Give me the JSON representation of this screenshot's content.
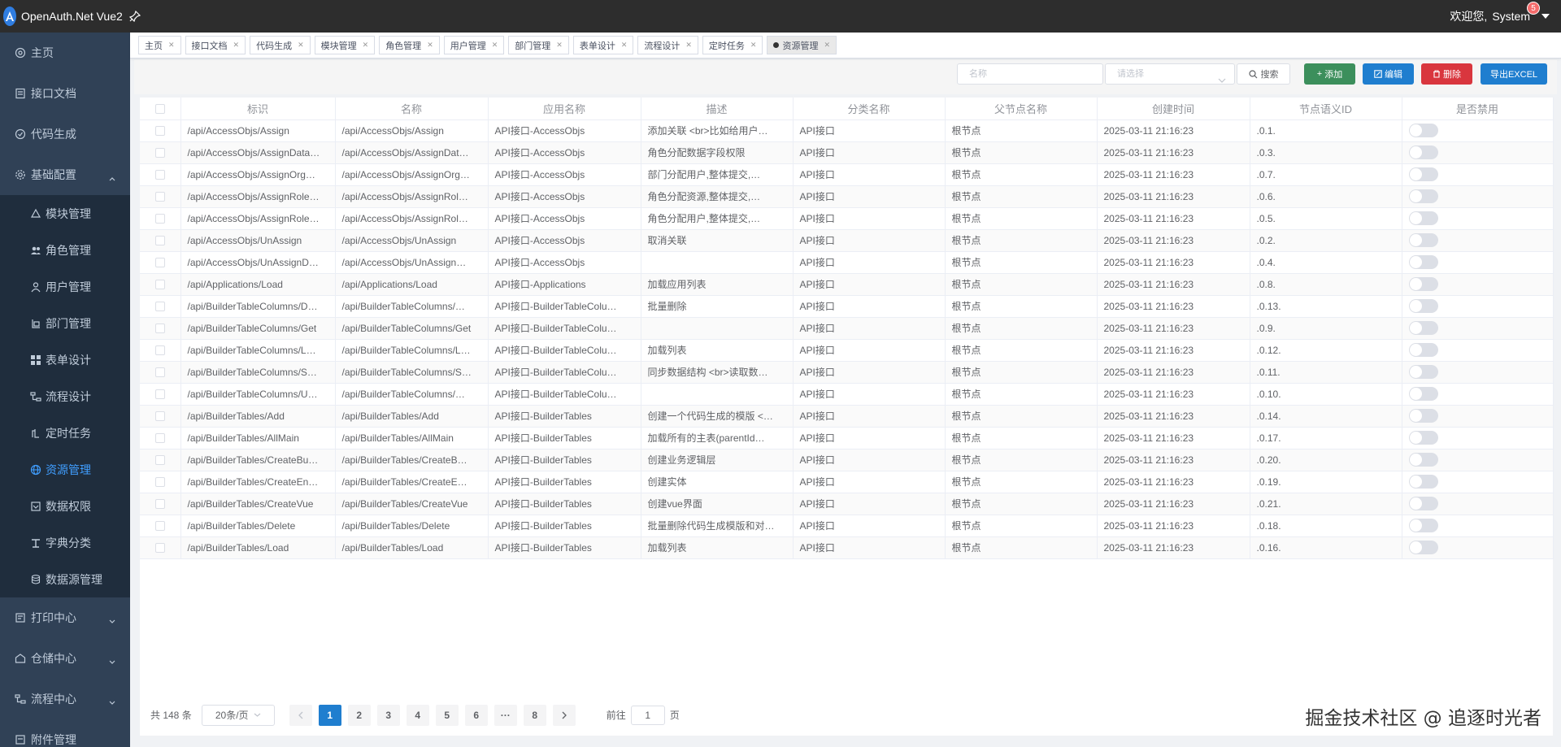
{
  "app": {
    "title": "OpenAuth.Net Vue2",
    "brand_color": "#2f7de1"
  },
  "user": {
    "greeting": "欢迎您,",
    "name": "System",
    "badge": "5"
  },
  "sidebar": {
    "items": [
      {
        "label": "主页",
        "icon": "home-icon"
      },
      {
        "label": "接口文档",
        "icon": "doc-icon"
      },
      {
        "label": "代码生成",
        "icon": "code-icon"
      },
      {
        "label": "基础配置",
        "icon": "gear-icon",
        "expanded": true
      }
    ],
    "sub_items": [
      {
        "label": "模块管理",
        "icon": "module-icon"
      },
      {
        "label": "角色管理",
        "icon": "role-icon"
      },
      {
        "label": "用户管理",
        "icon": "user-icon"
      },
      {
        "label": "部门管理",
        "icon": "dept-icon"
      },
      {
        "label": "表单设计",
        "icon": "form-icon"
      },
      {
        "label": "流程设计",
        "icon": "flow-icon"
      },
      {
        "label": "定时任务",
        "icon": "clock-icon"
      },
      {
        "label": "资源管理",
        "icon": "globe-icon",
        "active": true
      },
      {
        "label": "数据权限",
        "icon": "lock-icon"
      },
      {
        "label": "字典分类",
        "icon": "dict-icon"
      },
      {
        "label": "数据源管理",
        "icon": "database-icon"
      }
    ],
    "bottom_items": [
      {
        "label": "打印中心",
        "icon": "print-icon"
      },
      {
        "label": "仓储中心",
        "icon": "warehouse-icon"
      },
      {
        "label": "流程中心",
        "icon": "process-icon"
      },
      {
        "label": "附件管理",
        "icon": "attach-icon"
      }
    ]
  },
  "tags": [
    {
      "label": "主页"
    },
    {
      "label": "接口文档"
    },
    {
      "label": "代码生成"
    },
    {
      "label": "模块管理"
    },
    {
      "label": "角色管理"
    },
    {
      "label": "用户管理"
    },
    {
      "label": "部门管理"
    },
    {
      "label": "表单设计"
    },
    {
      "label": "流程设计"
    },
    {
      "label": "定时任务"
    },
    {
      "label": "资源管理",
      "active": true
    }
  ],
  "toolbar": {
    "name_placeholder": "名称",
    "select_placeholder": "请选择",
    "search_label": "搜索",
    "add_label": "添加",
    "edit_label": "编辑",
    "delete_label": "删除",
    "export_label": "导出EXCEL"
  },
  "table": {
    "columns": [
      "标识",
      "名称",
      "应用名称",
      "描述",
      "分类名称",
      "父节点名称",
      "创建时间",
      "节点语义ID",
      "是否禁用"
    ],
    "rows": [
      [
        "/api/AccessObjs/Assign",
        "/api/AccessObjs/Assign",
        "API接口-AccessObjs",
        "添加关联 <br>比如给用户…",
        "API接口",
        "根节点",
        "2025-03-11 21:16:23",
        ".0.1."
      ],
      [
        "/api/AccessObjs/AssignData…",
        "/api/AccessObjs/AssignDat…",
        "API接口-AccessObjs",
        "角色分配数据字段权限",
        "API接口",
        "根节点",
        "2025-03-11 21:16:23",
        ".0.3."
      ],
      [
        "/api/AccessObjs/AssignOrg…",
        "/api/AccessObjs/AssignOrg…",
        "API接口-AccessObjs",
        "部门分配用户,整体提交,…",
        "API接口",
        "根节点",
        "2025-03-11 21:16:23",
        ".0.7."
      ],
      [
        "/api/AccessObjs/AssignRole…",
        "/api/AccessObjs/AssignRol…",
        "API接口-AccessObjs",
        "角色分配资源,整体提交,…",
        "API接口",
        "根节点",
        "2025-03-11 21:16:23",
        ".0.6."
      ],
      [
        "/api/AccessObjs/AssignRole…",
        "/api/AccessObjs/AssignRol…",
        "API接口-AccessObjs",
        "角色分配用户,整体提交,…",
        "API接口",
        "根节点",
        "2025-03-11 21:16:23",
        ".0.5."
      ],
      [
        "/api/AccessObjs/UnAssign",
        "/api/AccessObjs/UnAssign",
        "API接口-AccessObjs",
        "取消关联",
        "API接口",
        "根节点",
        "2025-03-11 21:16:23",
        ".0.2."
      ],
      [
        "/api/AccessObjs/UnAssignD…",
        "/api/AccessObjs/UnAssign…",
        "API接口-AccessObjs",
        "",
        "API接口",
        "根节点",
        "2025-03-11 21:16:23",
        ".0.4."
      ],
      [
        "/api/Applications/Load",
        "/api/Applications/Load",
        "API接口-Applications",
        "加载应用列表",
        "API接口",
        "根节点",
        "2025-03-11 21:16:23",
        ".0.8."
      ],
      [
        "/api/BuilderTableColumns/D…",
        "/api/BuilderTableColumns/…",
        "API接口-BuilderTableColu…",
        "批量删除",
        "API接口",
        "根节点",
        "2025-03-11 21:16:23",
        ".0.13."
      ],
      [
        "/api/BuilderTableColumns/Get",
        "/api/BuilderTableColumns/Get",
        "API接口-BuilderTableColu…",
        "",
        "API接口",
        "根节点",
        "2025-03-11 21:16:23",
        ".0.9."
      ],
      [
        "/api/BuilderTableColumns/L…",
        "/api/BuilderTableColumns/L…",
        "API接口-BuilderTableColu…",
        "加载列表",
        "API接口",
        "根节点",
        "2025-03-11 21:16:23",
        ".0.12."
      ],
      [
        "/api/BuilderTableColumns/S…",
        "/api/BuilderTableColumns/S…",
        "API接口-BuilderTableColu…",
        "同步数据结构 <br>读取数…",
        "API接口",
        "根节点",
        "2025-03-11 21:16:23",
        ".0.11."
      ],
      [
        "/api/BuilderTableColumns/U…",
        "/api/BuilderTableColumns/…",
        "API接口-BuilderTableColu…",
        "",
        "API接口",
        "根节点",
        "2025-03-11 21:16:23",
        ".0.10."
      ],
      [
        "/api/BuilderTables/Add",
        "/api/BuilderTables/Add",
        "API接口-BuilderTables",
        "创建一个代码生成的模版 <…",
        "API接口",
        "根节点",
        "2025-03-11 21:16:23",
        ".0.14."
      ],
      [
        "/api/BuilderTables/AllMain",
        "/api/BuilderTables/AllMain",
        "API接口-BuilderTables",
        "加载所有的主表(parentId…",
        "API接口",
        "根节点",
        "2025-03-11 21:16:23",
        ".0.17."
      ],
      [
        "/api/BuilderTables/CreateBu…",
        "/api/BuilderTables/CreateB…",
        "API接口-BuilderTables",
        "创建业务逻辑层",
        "API接口",
        "根节点",
        "2025-03-11 21:16:23",
        ".0.20."
      ],
      [
        "/api/BuilderTables/CreateEn…",
        "/api/BuilderTables/CreateE…",
        "API接口-BuilderTables",
        "创建实体",
        "API接口",
        "根节点",
        "2025-03-11 21:16:23",
        ".0.19."
      ],
      [
        "/api/BuilderTables/CreateVue",
        "/api/BuilderTables/CreateVue",
        "API接口-BuilderTables",
        "创建vue界面",
        "API接口",
        "根节点",
        "2025-03-11 21:16:23",
        ".0.21."
      ],
      [
        "/api/BuilderTables/Delete",
        "/api/BuilderTables/Delete",
        "API接口-BuilderTables",
        "批量删除代码生成模版和对…",
        "API接口",
        "根节点",
        "2025-03-11 21:16:23",
        ".0.18."
      ],
      [
        "/api/BuilderTables/Load",
        "/api/BuilderTables/Load",
        "API接口-BuilderTables",
        "加载列表",
        "API接口",
        "根节点",
        "2025-03-11 21:16:23",
        ".0.16."
      ]
    ]
  },
  "pagination": {
    "total": "共 148 条",
    "page_size": "20条/页",
    "pages": [
      "1",
      "2",
      "3",
      "4",
      "5",
      "6",
      "···",
      "8"
    ],
    "current": "1",
    "goto_label": "前往",
    "goto_value": "1",
    "page_suffix": "页"
  },
  "watermark": "掘金技术社区 @ 追逐时光者"
}
